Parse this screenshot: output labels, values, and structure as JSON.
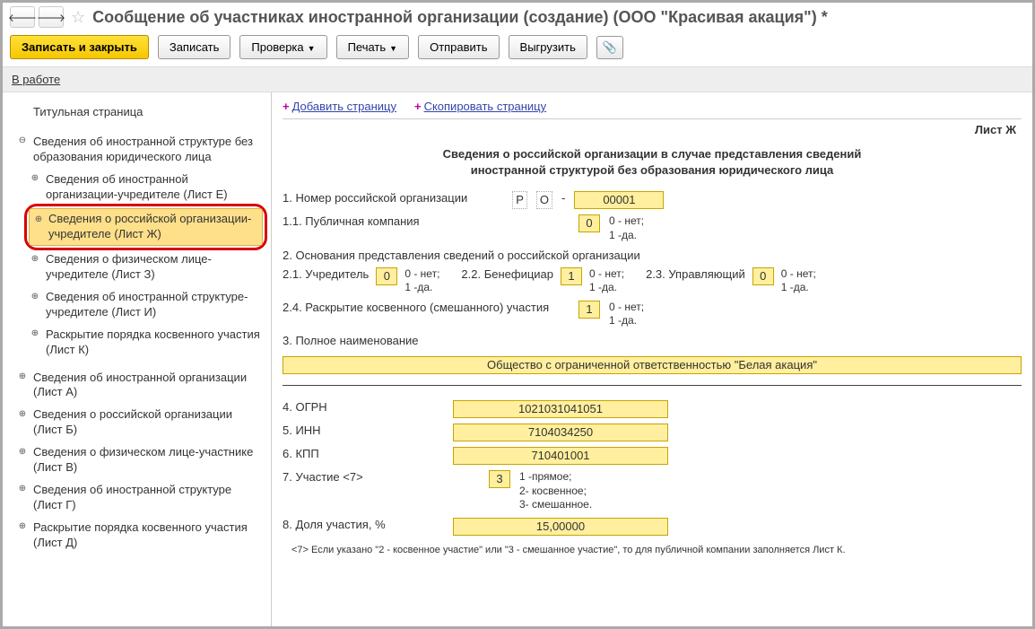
{
  "header": {
    "title": "Сообщение об участниках иностранной организации (создание) (ООО \"Красивая акация\") *"
  },
  "toolbar": {
    "save_close": "Записать и закрыть",
    "save": "Записать",
    "check": "Проверка",
    "print": "Печать",
    "send": "Отправить",
    "export": "Выгрузить"
  },
  "status": {
    "link": "В работе"
  },
  "sidebar": {
    "item0": "Титульная страница",
    "item1": "Сведения об иностранной структуре без образования юридического лица",
    "child1": "Сведения об иностранной организации-учредителе (Лист Е)",
    "child2": "Сведения о российской организации-учредителе (Лист Ж)",
    "child3": "Сведения о физическом лице-учредителе (Лист З)",
    "child4": "Сведения об иностранной структуре-учредителе (Лист И)",
    "child5": "Раскрытие порядка косвенного участия (Лист К)",
    "item2": "Сведения об иностранной организации (Лист А)",
    "item3": "Сведения о российской организации (Лист Б)",
    "item4": "Сведения о физическом лице-участнике (Лист В)",
    "item5": "Сведения об иностранной структуре (Лист Г)",
    "item6": "Раскрытие порядка косвенного участия (Лист Д)"
  },
  "content": {
    "add_page": "Добавить страницу",
    "copy_page": "Скопировать страницу",
    "sheet": "Лист Ж",
    "section_title_l1": "Сведения о российской организации в случае представления сведений",
    "section_title_l2": "иностранной структурой без образования юридического лица",
    "f1_label": "1. Номер российской организации",
    "f1_pref_p": "Р",
    "f1_pref_o": "О",
    "f1_dash": "-",
    "f1_value": "00001",
    "f11_label": "1.1. Публичная компания",
    "f11_value": "0",
    "hint_01": "0 - нет;",
    "hint_01b": "1 -да.",
    "f2_label": "2. Основания представления сведений о российской организации",
    "f21_label": "2.1. Учредитель",
    "f21_value": "0",
    "f22_label": "2.2. Бенефициар",
    "f22_value": "1",
    "f23_label": "2.3. Управляющий",
    "f23_value": "0",
    "f24_label": "2.4. Раскрытие косвенного (смешанного) участия",
    "f24_value": "1",
    "f3_label": "3. Полное наименование",
    "f3_value": "Общество с ограниченной ответственностью \"Белая акация\"",
    "f4_label": "4. ОГРН",
    "f4_value": "1021031041051",
    "f5_label": "5. ИНН",
    "f5_value": "7104034250",
    "f6_label": "6. КПП",
    "f6_value": "710401001",
    "f7_label": "7. Участие <7>",
    "f7_value": "3",
    "f7_h1": "1 -прямое;",
    "f7_h2": "2- косвенное;",
    "f7_h3": "3- смешанное.",
    "f8_label": "8. Доля участия, %",
    "f8_value": "15,00000",
    "footnote": "<7> Если указано \"2 - косвенное участие\" или \"3 - смешанное участие\", то для публичной компании заполняется Лист К."
  }
}
